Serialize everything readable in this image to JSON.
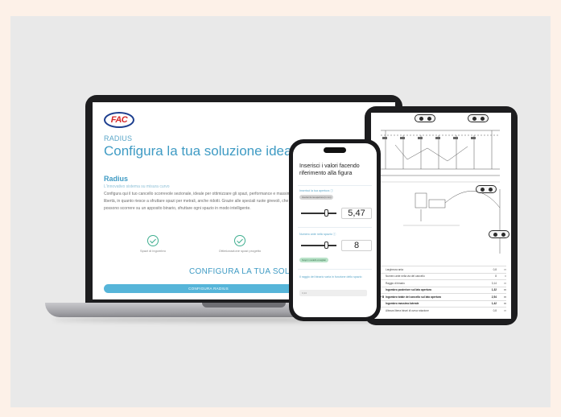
{
  "laptop": {
    "logo": "FAC",
    "eyebrow": "RADIUS",
    "title": "Configura la tua soluzione ideale",
    "subheading": "Radius",
    "tagline": "L'innovativo sistema su misura curvo",
    "body": "Configura qui il tuo cancello scorrevole sezionale, ideale per ottimizzare gli spazi, performance e massima libertà, in quanto riesce a sfruttare spazi per metrali, anche ridotti. Grazie alle speciali ruote girevoli, che possono scorrere su un apposito binario, sfruttare ogni spazio in modo intelligente.",
    "features": [
      "Spazi di ingombro",
      "Ottimizzazione spazi progetto"
    ],
    "cta_title": "CONFIGURA LA TUA SOLUZIONE",
    "cta_button": "CONFIGURA RADIUS"
  },
  "phone": {
    "heading": "Inserisci i valori facendo riferimento alla figura",
    "field1": {
      "label": "Inserisci la tua apertura  ⓘ",
      "pill": "Inserisci la tua apertura (in mm)",
      "value": "5,47",
      "level": 0.72
    },
    "field2": {
      "label": "Numero ante nello spazio  ⓘ",
      "pill": "Scopri i modelli consigliati",
      "value": "8",
      "level": 0.72
    },
    "field3": {
      "label": "Il raggio del binario varia in funzione dello spazio",
      "input": "3,14"
    }
  },
  "tablet": {
    "table": [
      {
        "k": "L",
        "d": "Larghezza anta",
        "v": "0,8",
        "u": "m"
      },
      {
        "k": "H",
        "d": "Numero ante nella via del cancello",
        "v": "8",
        "u": "n"
      },
      {
        "k": "R",
        "d": "Raggio di binario",
        "v": "3,14",
        "u": "m"
      },
      {
        "k": "A",
        "d": "Ingombro posteriore sul lato apertura",
        "v": "1,32",
        "u": "m"
      },
      {
        "k": "A + B",
        "d": "Ingombro totale del cancello sul lato apertura",
        "v": "2,54",
        "u": "m"
      },
      {
        "k": "C",
        "d": "Ingombro massimo laterale",
        "v": "1,42",
        "u": "m"
      },
      {
        "k": "D",
        "d": "Altezza libera binari di curva rotazione",
        "v": "0,8",
        "u": "m"
      }
    ],
    "highlight_rows": [
      3,
      4,
      5
    ]
  },
  "colors": {
    "accent": "#3f9bc4",
    "button": "#56b5d9",
    "check": "#3fae8f",
    "logo_red": "#d62828",
    "logo_blue": "#1d3f8f",
    "background": "#fdf1e8",
    "card": "#e9e9e9"
  }
}
